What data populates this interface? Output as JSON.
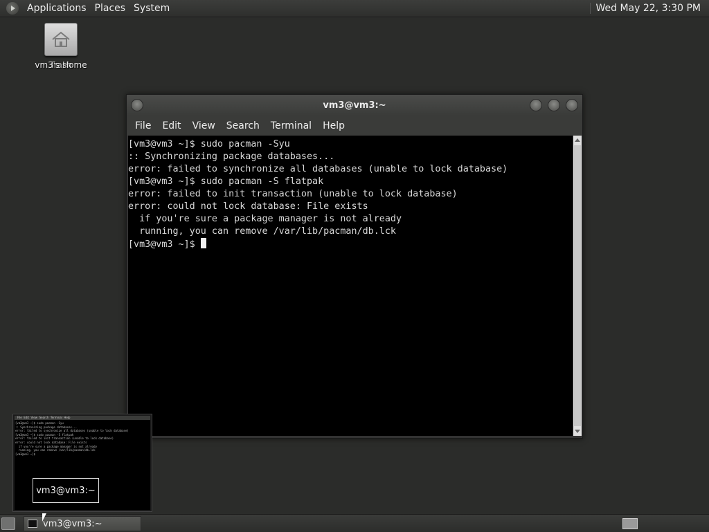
{
  "top_panel": {
    "menus": [
      "Applications",
      "Places",
      "System"
    ],
    "clock": "Wed May 22,  3:30 PM"
  },
  "desktop_icon": {
    "label_front": "vm3's Home",
    "label_back": "Trash",
    "icon": "home-folder-icon"
  },
  "window": {
    "title": "vm3@vm3:~",
    "menu": [
      "File",
      "Edit",
      "View",
      "Search",
      "Terminal",
      "Help"
    ],
    "terminal_lines": [
      "[vm3@vm3 ~]$ sudo pacman -Syu",
      ":: Synchronizing package databases...",
      "error: failed to synchronize all databases (unable to lock database)",
      "[vm3@vm3 ~]$ sudo pacman -S flatpak",
      "error: failed to init transaction (unable to lock database)",
      "error: could not lock database: File exists",
      "  if you're sure a package manager is not already",
      "  running, you can remove /var/lib/pacman/db.lck"
    ],
    "prompt": "[vm3@vm3 ~]$ "
  },
  "preview": {
    "title": "vm3@vm3:~"
  },
  "taskbar": {
    "task_label": "vm3@vm3:~"
  },
  "colors": {
    "desktop_bg": "#2b2c2a",
    "terminal_bg": "#000000",
    "terminal_fg": "#d8d8d8"
  }
}
